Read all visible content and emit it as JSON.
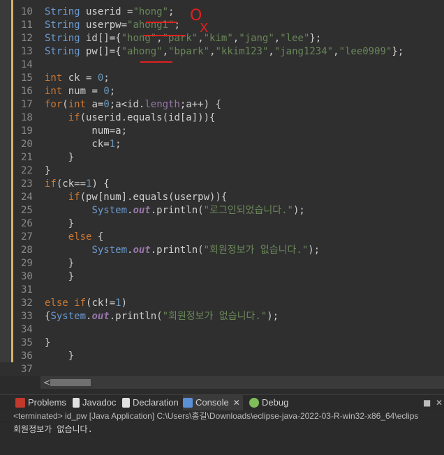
{
  "code": {
    "lines": [
      {
        "n": "10",
        "tokens": [
          [
            "type",
            "String"
          ],
          [
            "var",
            " userid ="
          ],
          [
            "str",
            "\"hong\""
          ],
          [
            "var",
            ";"
          ]
        ]
      },
      {
        "n": "11",
        "tokens": [
          [
            "type",
            "String"
          ],
          [
            "var",
            " userpw="
          ],
          [
            "str",
            "\"ahong1\""
          ],
          [
            "var",
            ";"
          ]
        ]
      },
      {
        "n": "12",
        "tokens": [
          [
            "type",
            "String"
          ],
          [
            "var",
            " id[]={"
          ],
          [
            "str",
            "\"hong\""
          ],
          [
            "var",
            ","
          ],
          [
            "str",
            "\"park\""
          ],
          [
            "var",
            ","
          ],
          [
            "str",
            "\"kim\""
          ],
          [
            "var",
            ","
          ],
          [
            "str",
            "\"jang\""
          ],
          [
            "var",
            ","
          ],
          [
            "str",
            "\"lee\""
          ],
          [
            "var",
            "};"
          ]
        ]
      },
      {
        "n": "13",
        "tokens": [
          [
            "type",
            "String"
          ],
          [
            "var",
            " pw[]={"
          ],
          [
            "str",
            "\"ahong\""
          ],
          [
            "var",
            ","
          ],
          [
            "str",
            "\"bpark\""
          ],
          [
            "var",
            ","
          ],
          [
            "str",
            "\"kkim123\""
          ],
          [
            "var",
            ","
          ],
          [
            "str",
            "\"jang1234\""
          ],
          [
            "var",
            ","
          ],
          [
            "str",
            "\"lee0909\""
          ],
          [
            "var",
            "};"
          ]
        ]
      },
      {
        "n": "14",
        "tokens": []
      },
      {
        "n": "15",
        "tokens": [
          [
            "kw",
            "int"
          ],
          [
            "var",
            " ck = "
          ],
          [
            "num",
            "0"
          ],
          [
            "var",
            ";"
          ]
        ]
      },
      {
        "n": "16",
        "tokens": [
          [
            "kw",
            "int"
          ],
          [
            "var",
            " num = "
          ],
          [
            "num",
            "0"
          ],
          [
            "var",
            ";"
          ]
        ]
      },
      {
        "n": "17",
        "tokens": [
          [
            "kw",
            "for"
          ],
          [
            "var",
            "("
          ],
          [
            "kw",
            "int"
          ],
          [
            "var",
            " a="
          ],
          [
            "num",
            "0"
          ],
          [
            "var",
            ";a<id."
          ],
          [
            "field",
            "length"
          ],
          [
            "var",
            ";a++) {"
          ]
        ]
      },
      {
        "n": "18",
        "tokens": [
          [
            "var",
            "    "
          ],
          [
            "kw",
            "if"
          ],
          [
            "var",
            "(userid.equals(id[a])){"
          ]
        ]
      },
      {
        "n": "19",
        "tokens": [
          [
            "var",
            "        num=a;"
          ]
        ]
      },
      {
        "n": "20",
        "tokens": [
          [
            "var",
            "        ck="
          ],
          [
            "num",
            "1"
          ],
          [
            "var",
            ";"
          ]
        ]
      },
      {
        "n": "21",
        "tokens": [
          [
            "var",
            "    }"
          ]
        ]
      },
      {
        "n": "22",
        "tokens": [
          [
            "var",
            "}"
          ]
        ]
      },
      {
        "n": "23",
        "tokens": [
          [
            "kw",
            "if"
          ],
          [
            "var",
            "(ck=="
          ],
          [
            "num",
            "1"
          ],
          [
            "var",
            ") {"
          ]
        ]
      },
      {
        "n": "24",
        "tokens": [
          [
            "var",
            "    "
          ],
          [
            "kw",
            "if"
          ],
          [
            "var",
            "(pw[num].equals(userpw)){"
          ]
        ]
      },
      {
        "n": "25",
        "tokens": [
          [
            "var",
            "        "
          ],
          [
            "type",
            "System"
          ],
          [
            "var",
            "."
          ],
          [
            "italic",
            "out"
          ],
          [
            "var",
            ".println("
          ],
          [
            "str",
            "\"로그인되었습니다.\""
          ],
          [
            "var",
            ");"
          ]
        ]
      },
      {
        "n": "26",
        "tokens": [
          [
            "var",
            "    }"
          ]
        ]
      },
      {
        "n": "27",
        "tokens": [
          [
            "var",
            "    "
          ],
          [
            "kw",
            "else"
          ],
          [
            "var",
            " {"
          ]
        ]
      },
      {
        "n": "28",
        "tokens": [
          [
            "var",
            "        "
          ],
          [
            "type",
            "System"
          ],
          [
            "var",
            "."
          ],
          [
            "italic",
            "out"
          ],
          [
            "var",
            ".println("
          ],
          [
            "str",
            "\"회원정보가 없습니다.\""
          ],
          [
            "var",
            ");"
          ]
        ]
      },
      {
        "n": "29",
        "tokens": [
          [
            "var",
            "    }"
          ]
        ]
      },
      {
        "n": "30",
        "tokens": [
          [
            "var",
            "    }"
          ]
        ]
      },
      {
        "n": "31",
        "tokens": []
      },
      {
        "n": "32",
        "tokens": [
          [
            "kw",
            "else"
          ],
          [
            "var",
            " "
          ],
          [
            "kw",
            "if"
          ],
          [
            "var",
            "(ck!="
          ],
          [
            "num",
            "1"
          ],
          [
            "var",
            ")"
          ]
        ]
      },
      {
        "n": "33",
        "tokens": [
          [
            "var",
            "{"
          ],
          [
            "type",
            "System"
          ],
          [
            "var",
            "."
          ],
          [
            "italic",
            "out"
          ],
          [
            "var",
            ".println("
          ],
          [
            "str",
            "\"회원정보가 없습니다.\""
          ],
          [
            "var",
            ");"
          ]
        ]
      },
      {
        "n": "34",
        "tokens": []
      },
      {
        "n": "35",
        "tokens": [
          [
            "var",
            "}"
          ]
        ]
      },
      {
        "n": "36",
        "tokens": [
          [
            "var",
            "    }"
          ]
        ]
      },
      {
        "n": "37",
        "tokens": []
      }
    ]
  },
  "annotations": {
    "circle_mark": "O",
    "x_mark": "X"
  },
  "tabs": [
    {
      "label": "Problems",
      "icon": "problems-icon",
      "icon_color": "#c0392b"
    },
    {
      "label": "Javadoc",
      "icon": "javadoc-icon",
      "icon_color": "#e0e0e0"
    },
    {
      "label": "Declaration",
      "icon": "declaration-icon",
      "icon_color": "#e0e0e0"
    },
    {
      "label": "Console",
      "icon": "console-icon",
      "icon_color": "#5b8fd6",
      "active": true
    },
    {
      "label": "Debug",
      "icon": "debug-icon",
      "icon_color": "#7fbf5a"
    }
  ],
  "console": {
    "header": "<terminated> id_pw [Java Application] C:\\Users\\홍길\\Downloads\\eclipse-java-2022-03-R-win32-x86_64\\eclips",
    "output": "회원정보가 없습니다."
  },
  "colors": {
    "editor_bg": "#2f2f2f",
    "string": "#6a8759",
    "keyword": "#cc7832",
    "type": "#6c9ad0",
    "annotation": "#e02020"
  }
}
